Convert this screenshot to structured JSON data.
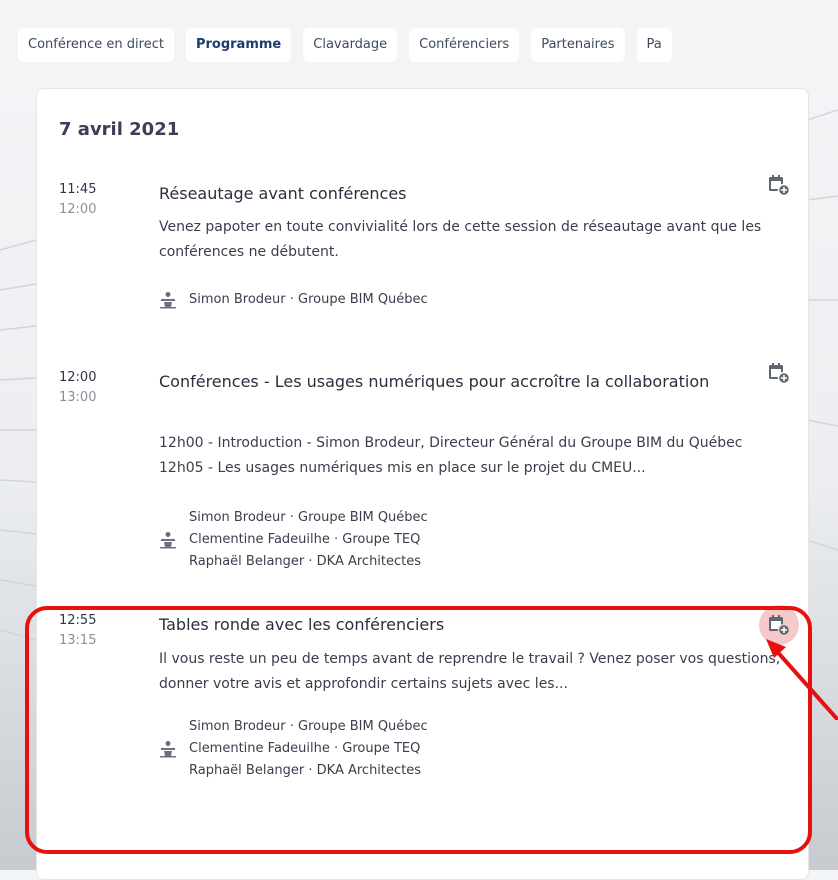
{
  "tabs": [
    {
      "label": "Conférence en direct",
      "active": false
    },
    {
      "label": "Programme",
      "active": true
    },
    {
      "label": "Clavardage",
      "active": false
    },
    {
      "label": "Conférenciers",
      "active": false
    },
    {
      "label": "Partenaires",
      "active": false
    },
    {
      "label": "Pa",
      "active": false
    }
  ],
  "day": {
    "date": "7 avril 2021"
  },
  "sessions": [
    {
      "start": "11:45",
      "end": "12:00",
      "title": "Réseautage avant conférences",
      "description": "Venez papoter en toute convivialité lors de cette session de réseautage avant que les conférences ne débutent.",
      "speakers": [
        "Simon Brodeur · Groupe BIM Québec"
      ],
      "icon": "calendar-add-icon"
    },
    {
      "start": "12:00",
      "end": "13:00",
      "title": "Conférences - Les usages numériques pour accroître la collaboration",
      "description": "12h00 - Introduction - Simon Brodeur, Directeur Général du Groupe BIM du Québec 12h05 - Les usages numériques mis en place sur le projet du CMEU...",
      "speakers": [
        "Simon Brodeur · Groupe BIM Québec",
        "Clementine Fadeuilhe · Groupe TEQ",
        "Raphaël Belanger · DKA Architectes"
      ],
      "icon": "calendar-add-icon"
    },
    {
      "start": "12:55",
      "end": "13:15",
      "title": "Tables ronde avec les conférenciers",
      "description": "Il vous reste un peu de temps avant de reprendre le travail ? Venez poser vos questions, donner votre avis et approfondir certains sujets avec les...",
      "speakers": [
        "Simon Brodeur · Groupe BIM Québec",
        "Clementine Fadeuilhe · Groupe TEQ",
        "Raphaël Belanger · DKA Architectes"
      ],
      "icon": "calendar-add-icon"
    }
  ],
  "colors": {
    "accent": "#1f3b6e",
    "annotation": "#e61010",
    "highlight": "#f6c9c9",
    "icon": "#5f6672"
  }
}
